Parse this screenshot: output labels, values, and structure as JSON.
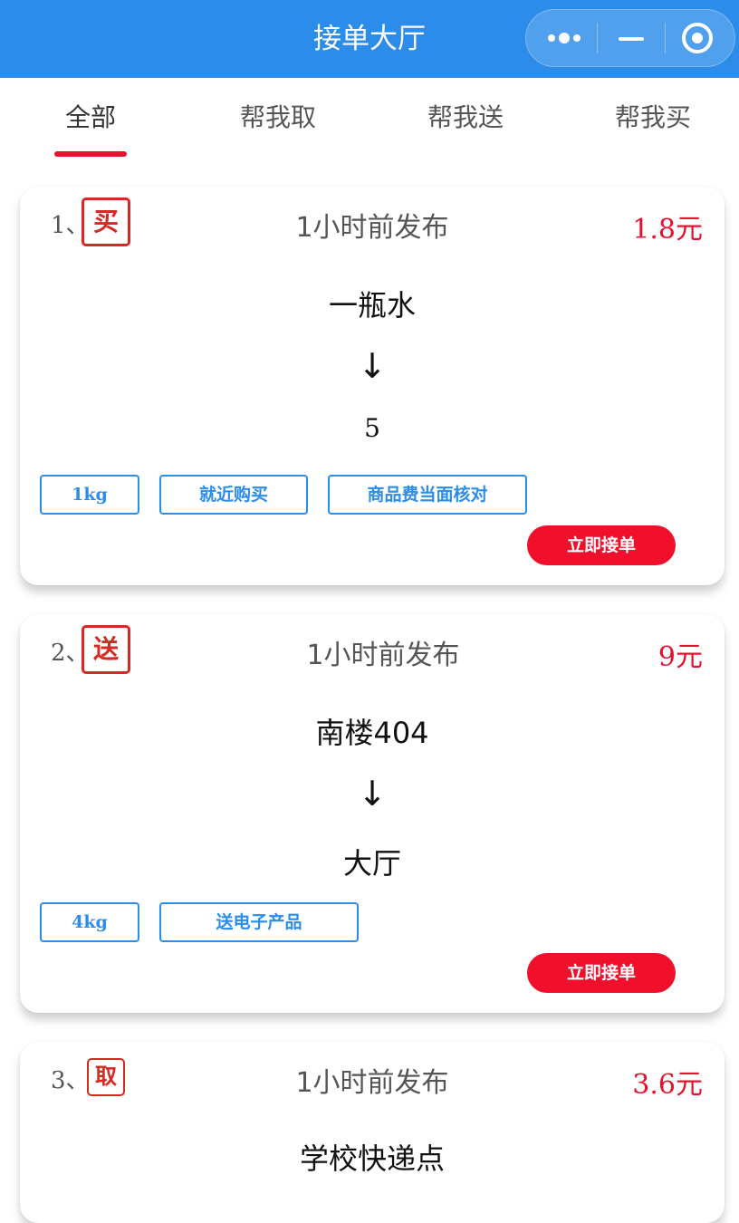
{
  "nav": {
    "title": "接单大厅"
  },
  "tabs": [
    {
      "label": "全部"
    },
    {
      "label": "帮我取"
    },
    {
      "label": "帮我送"
    },
    {
      "label": "帮我买"
    }
  ],
  "colors": {
    "nav_bg": "#2b8cea",
    "accent_red": "#e8112d",
    "tag_blue": "#2b8cea"
  },
  "orders": [
    {
      "index": "1、",
      "type": "买",
      "posted": "1小时前发布",
      "price": "1.8元",
      "from": "一瓶水",
      "arrow": "↓",
      "to": "5",
      "tags": [
        "1kg",
        "就近购买",
        "商品费当面核对"
      ],
      "accept_label": "立即接单"
    },
    {
      "index": "2、",
      "type": "送",
      "posted": "1小时前发布",
      "price": "9元",
      "from": "南楼404",
      "arrow": "↓",
      "to": "大厅",
      "tags": [
        "4kg",
        "送电子产品"
      ],
      "accept_label": "立即接单"
    },
    {
      "index": "3、",
      "type": "取",
      "posted": "1小时前发布",
      "price": "3.6元",
      "from": "学校快递点"
    }
  ]
}
